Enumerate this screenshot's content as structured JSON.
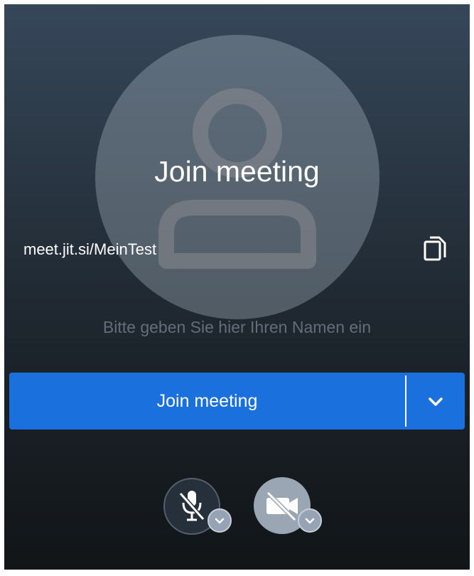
{
  "prejoin": {
    "title": "Join meeting",
    "meeting_url": "meet.jit.si/MeinTest",
    "name_input": {
      "placeholder": "Bitte geben Sie hier Ihren Namen ein",
      "value": ""
    },
    "join_button": {
      "label": "Join meeting",
      "options_icon": "chevron-down-icon"
    },
    "media": {
      "microphone": {
        "icon": "microphone-off-icon",
        "state": "muted"
      },
      "camera": {
        "icon": "camera-off-icon",
        "state": "off"
      }
    }
  },
  "colors": {
    "join_button": "#1a70dc",
    "background_top": "#36475a",
    "background_bottom": "#111518",
    "placeholder_text": "#626e7a"
  }
}
